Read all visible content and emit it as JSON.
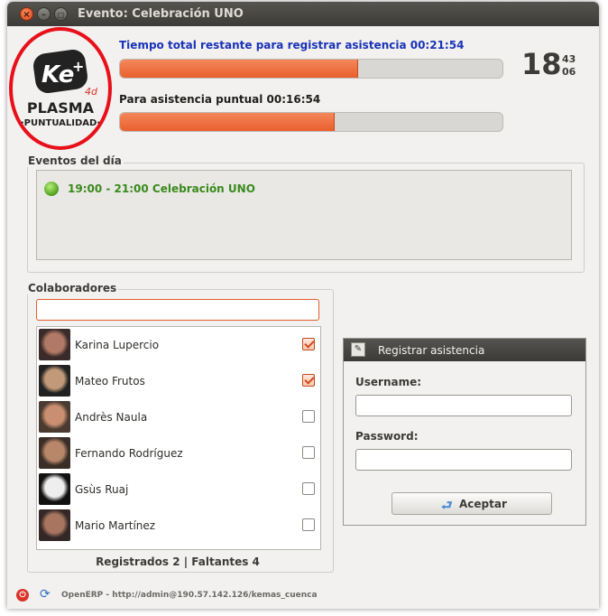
{
  "window": {
    "title": "Evento: Celebración UNO"
  },
  "logo": {
    "brand": "Ke",
    "superscript": "4d",
    "line1": "PLASMA",
    "line2": "PUNTUALIDAD"
  },
  "progress": {
    "total_label": "Tiempo total restante para registrar asistencia 00:21:54",
    "total_fraction": 0.62,
    "punctual_label": "Para asistencia puntual 00:16:54",
    "punctual_fraction": 0.56
  },
  "clock": {
    "hour": "18",
    "minute": "43",
    "second": "06"
  },
  "events": {
    "title": "Eventos del día",
    "items": [
      {
        "text": "19:00 - 21:00   Celebración UNO"
      }
    ]
  },
  "collaborators": {
    "title": "Colaboradores",
    "search_value": "",
    "people": [
      {
        "name": "Karina Lupercio",
        "checked": true
      },
      {
        "name": "Mateo Frutos",
        "checked": true
      },
      {
        "name": "Andrès Naula",
        "checked": false
      },
      {
        "name": "Fernando Rodríguez",
        "checked": false
      },
      {
        "name": "Gsùs Ruaj",
        "checked": false
      },
      {
        "name": "Mario Martínez",
        "checked": false
      }
    ],
    "summary": "Registrados 2 | Faltantes 4"
  },
  "register": {
    "title": "Registrar asistencia",
    "username_label": "Username:",
    "password_label": "Password:",
    "username_value": "",
    "password_value": "",
    "button_label": "Aceptar"
  },
  "status": {
    "text": "OpenERP - http://admin@190.57.142.126/kemas_cuenca"
  },
  "colors": {
    "accent": "#e95f2e",
    "event_green": "#3a8a1c",
    "title_blue": "#1a33b8"
  }
}
